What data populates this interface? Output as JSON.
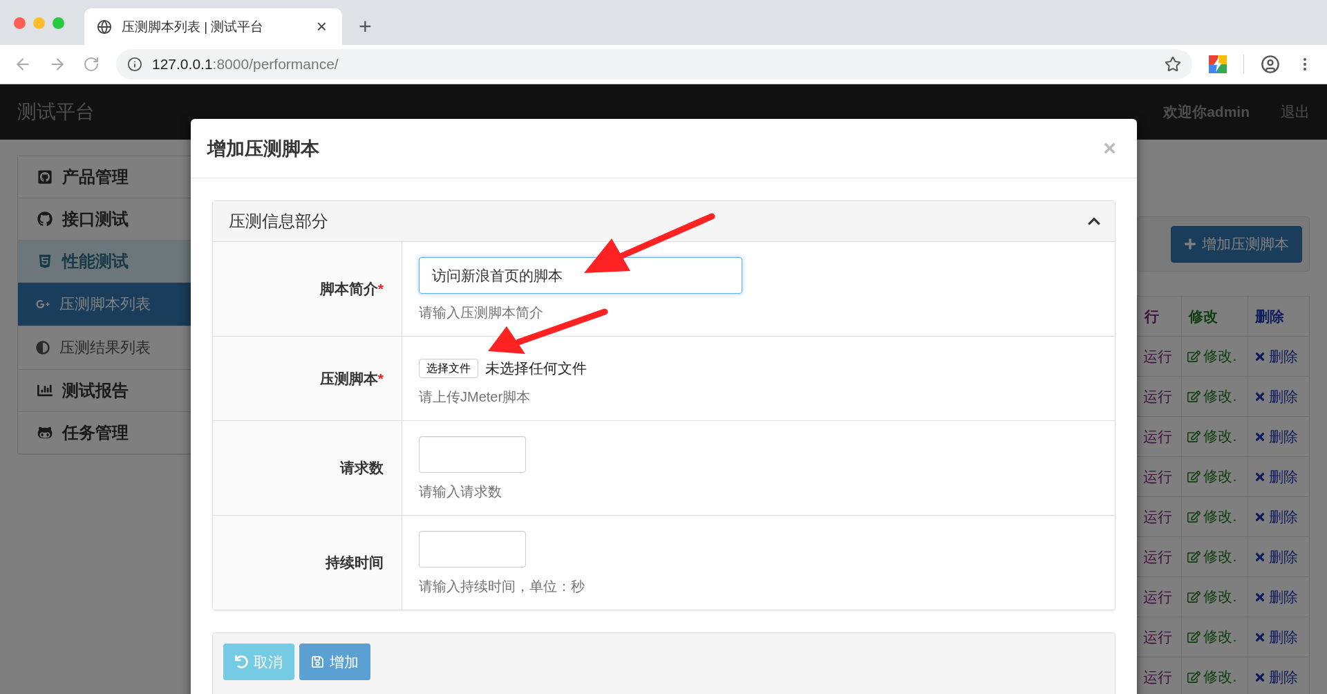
{
  "browser": {
    "tab_title": "压测脚本列表 | 测试平台",
    "close_tab": "×",
    "new_tab": "+",
    "url_host": "127.0.0.1",
    "url_path": ":8000/performance/"
  },
  "navbar": {
    "brand": "测试平台",
    "welcome": "欢迎你admin",
    "logout": "退出"
  },
  "sidebar": {
    "items": [
      {
        "label": "产品管理",
        "selected": false
      },
      {
        "label": "接口测试",
        "selected": false
      },
      {
        "label": "性能测试",
        "selected": true,
        "children": [
          {
            "label": "压测脚本列表",
            "selected": true
          },
          {
            "label": "压测结果列表",
            "selected": false
          }
        ]
      },
      {
        "label": "测试报告",
        "selected": false
      },
      {
        "label": "任务管理",
        "selected": false
      }
    ]
  },
  "toolbar": {
    "add_button": "增加压测脚本"
  },
  "table": {
    "columns": [
      "行",
      "修改",
      "删除"
    ],
    "rows": [
      {
        "run": "运行",
        "edit": "修改.",
        "delete": "删除"
      },
      {
        "run": "运行",
        "edit": "修改.",
        "delete": "删除"
      },
      {
        "run": "运行",
        "edit": "修改.",
        "delete": "删除"
      },
      {
        "run": "运行",
        "edit": "修改.",
        "delete": "删除"
      },
      {
        "run": "运行",
        "edit": "修改.",
        "delete": "删除"
      },
      {
        "run": "运行",
        "edit": "修改.",
        "delete": "删除"
      },
      {
        "run": "运行",
        "edit": "修改.",
        "delete": "删除"
      },
      {
        "run": "运行",
        "edit": "修改.",
        "delete": "删除"
      },
      {
        "run": "运行",
        "edit": "修改.",
        "delete": "删除"
      }
    ]
  },
  "modal": {
    "title": "增加压测脚本",
    "close": "×",
    "required_mark": "*",
    "panel": {
      "title": "压测信息部分",
      "expanded": true,
      "fields": [
        {
          "kind": "text",
          "label": "脚本简介",
          "required": true,
          "value": "访问新浪首页的脚本",
          "focused": true,
          "help": "请输入压测脚本简介"
        },
        {
          "kind": "file",
          "label": "压测脚本",
          "required": true,
          "button": "选择文件",
          "status": "未选择任何文件",
          "help": "请上传JMeter脚本"
        },
        {
          "kind": "number",
          "label": "请求数",
          "required": false,
          "focused": false,
          "help": "请输入请求数"
        },
        {
          "kind": "number",
          "label": "持续时间",
          "required": false,
          "focused": false,
          "help": "请输入持续时间，单位：秒"
        }
      ]
    },
    "buttons": [
      {
        "kind": "cancel",
        "label": "取消"
      },
      {
        "kind": "submit",
        "label": "增加"
      }
    ]
  }
}
